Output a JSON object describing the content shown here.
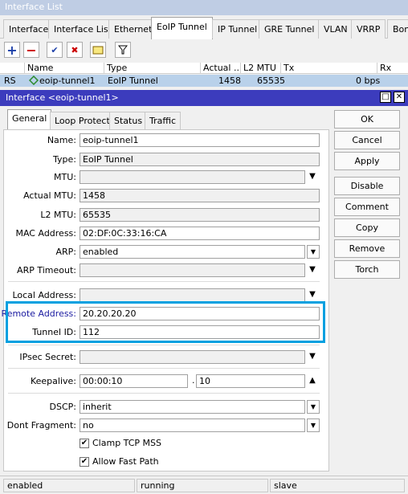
{
  "window": {
    "title": "Interface List"
  },
  "tabs": [
    "Interface",
    "Interface List",
    "Ethernet",
    "EoIP Tunnel",
    "IP Tunnel",
    "GRE Tunnel",
    "VLAN",
    "VRRP",
    "Bond"
  ],
  "toolbar": {
    "add_icon": "+",
    "remove_icon": "−",
    "enable_icon": "✔",
    "disable_icon": "✖",
    "comment_icon": "comment-icon",
    "filter_icon": "filter-icon"
  },
  "list": {
    "columns": [
      "Name",
      "Type",
      "Actual ...",
      "L2 MTU",
      "Tx",
      "Rx"
    ],
    "row": {
      "flags": "RS",
      "name": "eoip-tunnel1",
      "type": "EoIP Tunnel",
      "actual_mtu": "1458",
      "l2mtu": "65535",
      "tx": "0 bps"
    }
  },
  "dialog": {
    "title": "Interface <eoip-tunnel1>",
    "tabs": [
      "General",
      "Loop Protect",
      "Status",
      "Traffic"
    ],
    "fields": {
      "name": {
        "label": "Name:",
        "value": "eoip-tunnel1"
      },
      "type": {
        "label": "Type:",
        "value": "EoIP Tunnel"
      },
      "mtu": {
        "label": "MTU:",
        "value": ""
      },
      "actual_mtu": {
        "label": "Actual MTU:",
        "value": "1458"
      },
      "l2mtu": {
        "label": "L2 MTU:",
        "value": "65535"
      },
      "mac": {
        "label": "MAC Address:",
        "value": "02:DF:0C:33:16:CA"
      },
      "arp": {
        "label": "ARP:",
        "value": "enabled"
      },
      "arp_timeout": {
        "label": "ARP Timeout:",
        "value": ""
      },
      "local_address": {
        "label": "Local Address:",
        "value": ""
      },
      "remote_address": {
        "label": "Remote Address:",
        "value": "20.20.20.20"
      },
      "tunnel_id": {
        "label": "Tunnel ID:",
        "value": "112"
      },
      "ipsec_secret": {
        "label": "IPsec Secret:",
        "value": ""
      },
      "keepalive": {
        "label": "Keepalive:",
        "value": "00:00:10",
        "value2": "10"
      },
      "dscp": {
        "label": "DSCP:",
        "value": "inherit"
      },
      "dont_fragment": {
        "label": "Dont Fragment:",
        "value": "no"
      }
    },
    "checkboxes": {
      "clamp": "Clamp TCP MSS",
      "allow_fast_path": "Allow Fast Path"
    },
    "buttons": [
      "OK",
      "Cancel",
      "Apply",
      "Disable",
      "Comment",
      "Copy",
      "Remove",
      "Torch"
    ]
  },
  "status": {
    "state": "enabled",
    "running": "running",
    "slave": "slave"
  },
  "colors": {
    "highlight": "#00a0e0",
    "dialog_title": "#3c3cbd",
    "selected_row": "#b9d1ea",
    "remote_label": "#1a1aa0"
  }
}
